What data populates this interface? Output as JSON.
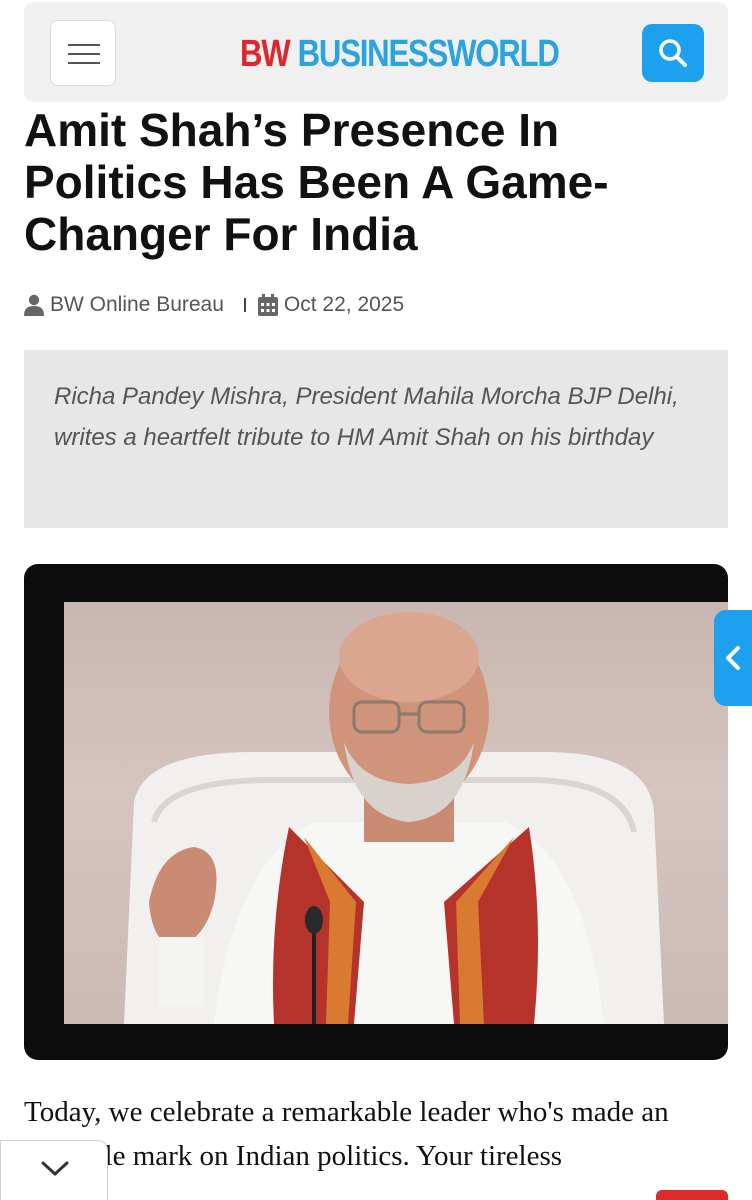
{
  "header": {
    "menu_icon": "hamburger-menu-icon",
    "logo_bw": "BW",
    "logo_name": "BUSINESSWORLD",
    "search_icon": "search-icon",
    "colors": {
      "logo_red": "#e0262c",
      "logo_blue": "#2aa3e0",
      "accent": "#1da1ef"
    }
  },
  "article": {
    "title": "Amit Shah’s Presence In Politics Has Been A Game-Changer For India",
    "author": "BW Online Bureau",
    "date": "Oct 22, 2025",
    "author_icon": "user-icon",
    "date_icon": "calendar-icon",
    "summary": "Richa Pandey Mishra, President Mahila Morcha BJP Delhi, writes a heartfelt tribute to HM Amit Shah on his birthday",
    "body": "Today, we celebrate a remarkable leader who's made an indelible mark on Indian politics. Your tireless"
  },
  "controls": {
    "side_tab_icon": "chevron-left-icon",
    "collapse_icon": "chevron-down-icon"
  }
}
